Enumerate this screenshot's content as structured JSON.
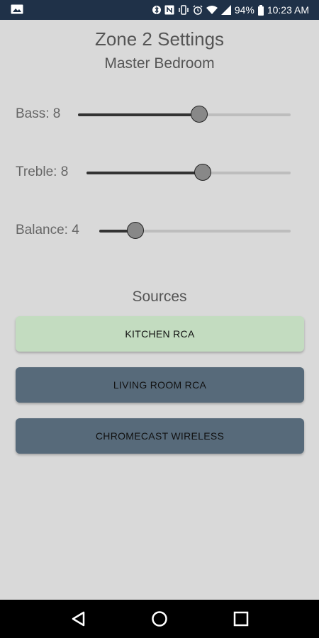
{
  "status_bar": {
    "battery": "94%",
    "time": "10:23 AM",
    "icons": [
      "image-icon",
      "bluetooth-icon",
      "nfc-icon",
      "vibrate-icon",
      "alarm-icon",
      "wifi-icon",
      "signal-icon",
      "battery-icon"
    ]
  },
  "header": {
    "title": "Zone 2 Settings",
    "subtitle": "Master Bedroom"
  },
  "sliders": [
    {
      "id": "bass",
      "label": "Bass: 8",
      "value": 0.57
    },
    {
      "id": "treble",
      "label": "Treble: 8",
      "value": 0.57
    },
    {
      "id": "balance",
      "label": "Balance: 4",
      "value": 0.19
    }
  ],
  "sources": {
    "heading": "Sources",
    "buttons": [
      {
        "label": "KITCHEN RCA",
        "selected": true,
        "color": "#c3dcc0"
      },
      {
        "label": "LIVING ROOM RCA",
        "selected": false,
        "color": "#576a7a"
      },
      {
        "label": "CHROMECAST WIRELESS",
        "selected": false,
        "color": "#576a7a"
      }
    ]
  },
  "nav_bar": {
    "icons": [
      "back-icon",
      "home-icon",
      "recents-icon"
    ]
  }
}
